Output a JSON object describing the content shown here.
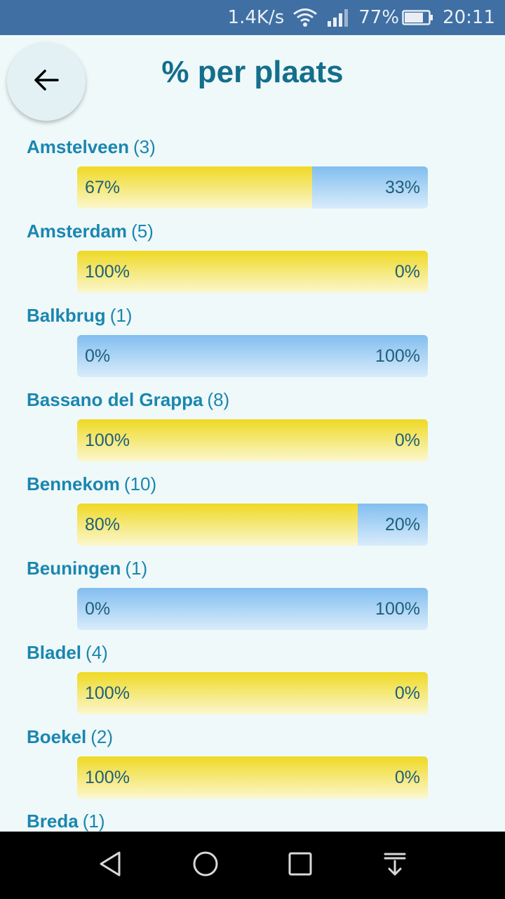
{
  "status_bar": {
    "speed": "1.4K/s",
    "battery": "77%",
    "time": "20:11",
    "icons": [
      "wifi-icon",
      "signal-icon",
      "battery-icon"
    ]
  },
  "header": {
    "title": "% per plaats",
    "back_icon": "arrow-left-icon"
  },
  "colors": {
    "yes": "#efd924",
    "no": "#82beef",
    "label": "#1a86b0",
    "title": "#146e8c"
  },
  "places": [
    {
      "name": "Amstelveen",
      "count": "(3)",
      "left_pct": "67%",
      "right_pct": "33%",
      "fill": 0.67
    },
    {
      "name": "Amsterdam",
      "count": "(5)",
      "left_pct": "100%",
      "right_pct": "0%",
      "fill": 1.0
    },
    {
      "name": "Balkbrug",
      "count": "(1)",
      "left_pct": "0%",
      "right_pct": "100%",
      "fill": 0.0
    },
    {
      "name": "Bassano del Grappa",
      "count": "(8)",
      "left_pct": "100%",
      "right_pct": "0%",
      "fill": 1.0
    },
    {
      "name": "Bennekom",
      "count": "(10)",
      "left_pct": "80%",
      "right_pct": "20%",
      "fill": 0.8
    },
    {
      "name": "Beuningen",
      "count": "(1)",
      "left_pct": "0%",
      "right_pct": "100%",
      "fill": 0.0
    },
    {
      "name": "Bladel",
      "count": "(4)",
      "left_pct": "100%",
      "right_pct": "0%",
      "fill": 1.0
    },
    {
      "name": "Boekel",
      "count": "(2)",
      "left_pct": "100%",
      "right_pct": "0%",
      "fill": 1.0
    },
    {
      "name": "Breda",
      "count": "(1)",
      "left_pct": "",
      "right_pct": "",
      "fill": 1.0
    }
  ],
  "nav_bar": {
    "icons": [
      "back-triangle-icon",
      "home-circle-icon",
      "recents-square-icon",
      "notification-pull-icon"
    ]
  }
}
